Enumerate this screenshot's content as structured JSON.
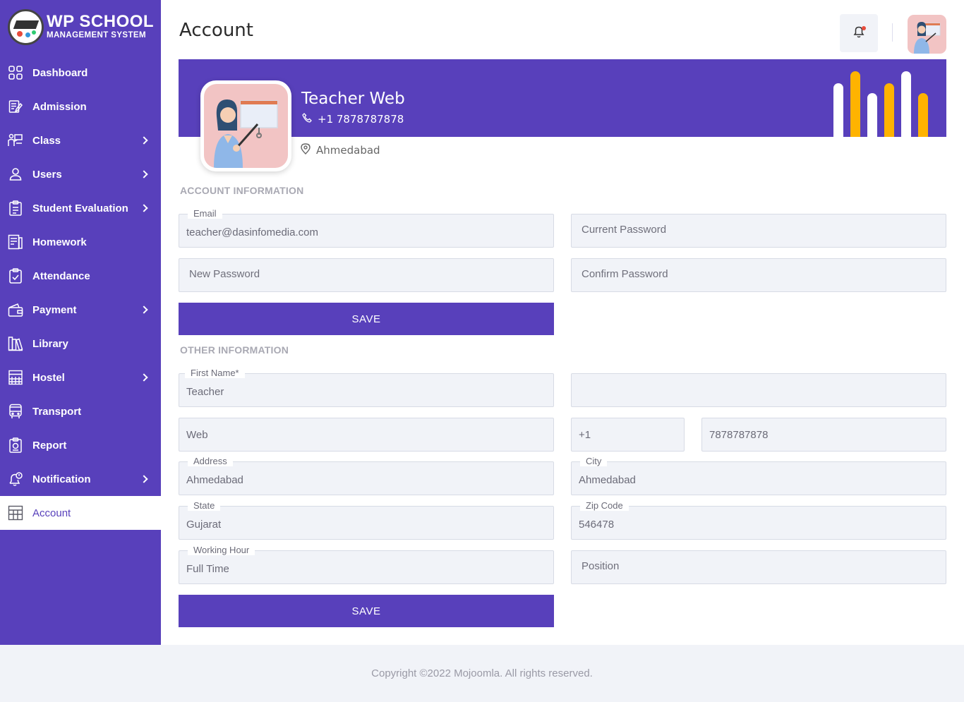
{
  "brand": {
    "title": "WP SCHOOL",
    "subtitle": "MANAGEMENT SYSTEM"
  },
  "sidebar": {
    "items": [
      {
        "label": "Dashboard",
        "icon": "dashboard-icon",
        "has_submenu": false
      },
      {
        "label": "Admission",
        "icon": "admission-icon",
        "has_submenu": false
      },
      {
        "label": "Class",
        "icon": "class-icon",
        "has_submenu": true
      },
      {
        "label": "Users",
        "icon": "user-icon",
        "has_submenu": true
      },
      {
        "label": "Student Evaluation",
        "icon": "evaluation-icon",
        "has_submenu": true
      },
      {
        "label": "Homework",
        "icon": "homework-icon",
        "has_submenu": false
      },
      {
        "label": "Attendance",
        "icon": "attendance-icon",
        "has_submenu": false
      },
      {
        "label": "Payment",
        "icon": "wallet-icon",
        "has_submenu": true
      },
      {
        "label": "Library",
        "icon": "library-icon",
        "has_submenu": false
      },
      {
        "label": "Hostel",
        "icon": "hostel-icon",
        "has_submenu": true
      },
      {
        "label": "Transport",
        "icon": "bus-icon",
        "has_submenu": false
      },
      {
        "label": "Report",
        "icon": "report-icon",
        "has_submenu": false
      },
      {
        "label": "Notification",
        "icon": "notification-icon",
        "has_submenu": true
      },
      {
        "label": "Account",
        "icon": "account-icon",
        "has_submenu": false,
        "active": true
      }
    ]
  },
  "header": {
    "title": "Account"
  },
  "profile": {
    "name": "Teacher Web",
    "phone": "+1  7878787878",
    "city": "Ahmedabad"
  },
  "account_info": {
    "section_title": "ACCOUNT INFORMATION",
    "email_label": "Email",
    "email_value": "teacher@dasinfomedia.com",
    "current_password_placeholder": "Current Password",
    "new_password_placeholder": "New Password",
    "confirm_password_placeholder": "Confirm Password",
    "save_label": "SAVE"
  },
  "other_info": {
    "section_title": "OTHER INFORMATION",
    "first_name_label": "First Name*",
    "first_name_value": "Teacher",
    "middle_name_value": "",
    "last_name_value": "Web",
    "phone_code": "+1",
    "phone_number": "7878787878",
    "address_label": "Address",
    "address_value": "Ahmedabad",
    "city_label": "City",
    "city_value": "Ahmedabad",
    "state_label": "State",
    "state_value": "Gujarat",
    "zip_label": "Zip Code",
    "zip_value": "546478",
    "working_hour_label": "Working Hour",
    "working_hour_value": "Full Time",
    "position_placeholder": "Position",
    "save_label": "SAVE"
  },
  "footer": {
    "copyright": "Copyright ©2022 Mojoomla. All rights reserved."
  },
  "colors": {
    "primary": "#5840bb",
    "accent": "#ffb300",
    "field_bg": "#f1f3f8",
    "avatar_bg": "#f2c4c4"
  }
}
